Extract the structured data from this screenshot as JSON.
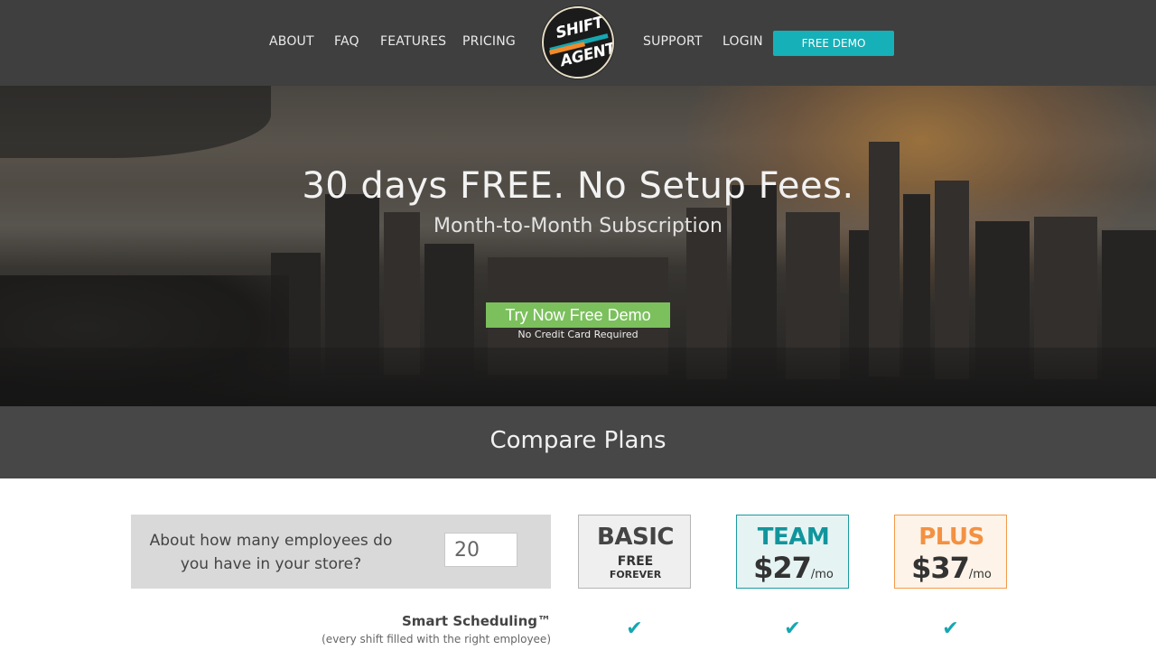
{
  "nav": {
    "left_links": [
      "ABOUT",
      "FAQ",
      "FEATURES",
      "PRICING"
    ],
    "right_links": [
      "SUPPORT",
      "LOGIN"
    ],
    "demo_button": "FREE DEMO",
    "logo": {
      "line1": "SHIFT",
      "line2": "AGENT"
    }
  },
  "hero": {
    "headline": "30 days FREE.  No Setup Fees.",
    "subheadline": "Month-to-Month Subscription",
    "cta_label": "Try Now Free Demo",
    "cta_note": "No Credit Card Required",
    "cta_color": "#7bc05d"
  },
  "compare": {
    "title": "Compare Plans"
  },
  "employee_question": {
    "label": "About how many employees do you have in your store?",
    "value": "20"
  },
  "plans": [
    {
      "name": "BASIC",
      "line1": "FREE",
      "line2": "FOREVER",
      "accent": "#444444"
    },
    {
      "name": "TEAM",
      "price": "$27",
      "per": "/mo",
      "accent": "#11959c"
    },
    {
      "name": "PLUS",
      "price": "$37",
      "per": "/mo",
      "accent": "#f39142"
    }
  ],
  "features": [
    {
      "title": "Smart Scheduling™",
      "subtitle": "(every shift filled with the right employee)",
      "checks": [
        "✔",
        "✔",
        "✔"
      ]
    }
  ],
  "colors": {
    "nav_bg": "#3f3f3f",
    "demo_button": "#16b0b8",
    "compare_bar": "#474747",
    "check": "#16a7b1"
  }
}
